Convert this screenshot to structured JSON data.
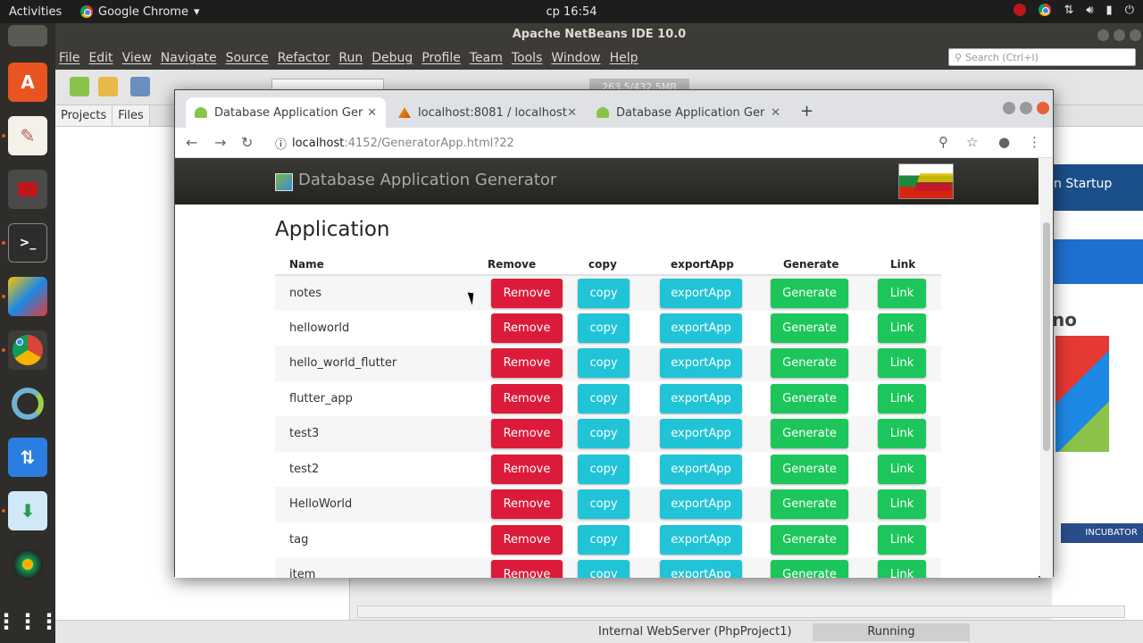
{
  "topbar": {
    "activities": "Activities",
    "app_name": "Google Chrome",
    "clock": "ср 16:54"
  },
  "ide": {
    "title": "Apache NetBeans IDE 10.0",
    "menu": [
      "File",
      "Edit",
      "View",
      "Navigate",
      "Source",
      "Refactor",
      "Run",
      "Debug",
      "Profile",
      "Team",
      "Tools",
      "Window",
      "Help"
    ],
    "search_placeholder": "Search (Ctrl+I)",
    "memory": "263.5/432.5MB",
    "panel_tabs": [
      "Projects",
      "Files"
    ],
    "right_text": "n Startup",
    "right_text2": "no",
    "right_badge": "INCUBATOR",
    "status_server": "Internal WebServer (PhpProject1)",
    "status_running": "Running"
  },
  "browser": {
    "tabs": [
      {
        "label": "Database Application Ger"
      },
      {
        "label": "localhost:8081 / localhost"
      },
      {
        "label": "Database Application Ger"
      }
    ],
    "url_host": "localhost",
    "url_path": ":4152/GeneratorApp.html?22"
  },
  "page": {
    "header_title": "Database Application Generator",
    "heading": "Application",
    "columns": [
      "Name",
      "Remove",
      "copy",
      "exportApp",
      "Generate",
      "Link"
    ],
    "button_labels": {
      "remove": "Remove",
      "copy": "copy",
      "export": "exportApp",
      "generate": "Generate",
      "link": "Link"
    },
    "rows": [
      "notes",
      "helloworld",
      "hello_world_flutter",
      "flutter_app",
      "test3",
      "test2",
      "HelloWorld",
      "tag",
      "item"
    ]
  }
}
